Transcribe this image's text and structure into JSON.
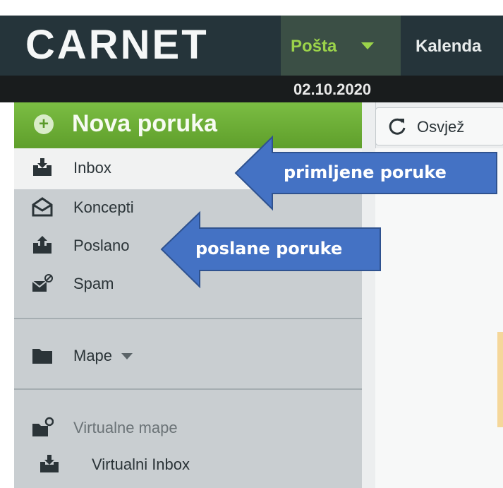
{
  "header": {
    "logo": "CARNET",
    "tabs": [
      {
        "label": "Pošta",
        "active": true
      },
      {
        "label": "Kalenda"
      }
    ],
    "date": "02.10.2020"
  },
  "sidebar": {
    "new_message": "Nova poruka",
    "folders": [
      {
        "label": "Inbox",
        "icon": "inbox-icon",
        "selected": true
      },
      {
        "label": "Koncepti",
        "icon": "drafts-icon"
      },
      {
        "label": "Poslano",
        "icon": "sent-icon"
      },
      {
        "label": "Spam",
        "icon": "spam-icon"
      }
    ],
    "folders_menu": {
      "label": "Mape",
      "icon": "folder-icon"
    },
    "virtual_folders": {
      "label": "Virtualne mape",
      "icon": "virtual-folder-icon"
    },
    "virtual_inbox": {
      "label": "Virtualni Inbox",
      "icon": "virtual-inbox-icon"
    }
  },
  "toolbar": {
    "refresh_label": "Osvjež"
  },
  "annotations": {
    "received": "primljene poruke",
    "sent": "poslane poruke"
  },
  "colors": {
    "topbar": "#25343a",
    "accent_green": "#6aae34",
    "callout_blue": "#4472c4",
    "sidebar_bg": "#c9ced1"
  }
}
